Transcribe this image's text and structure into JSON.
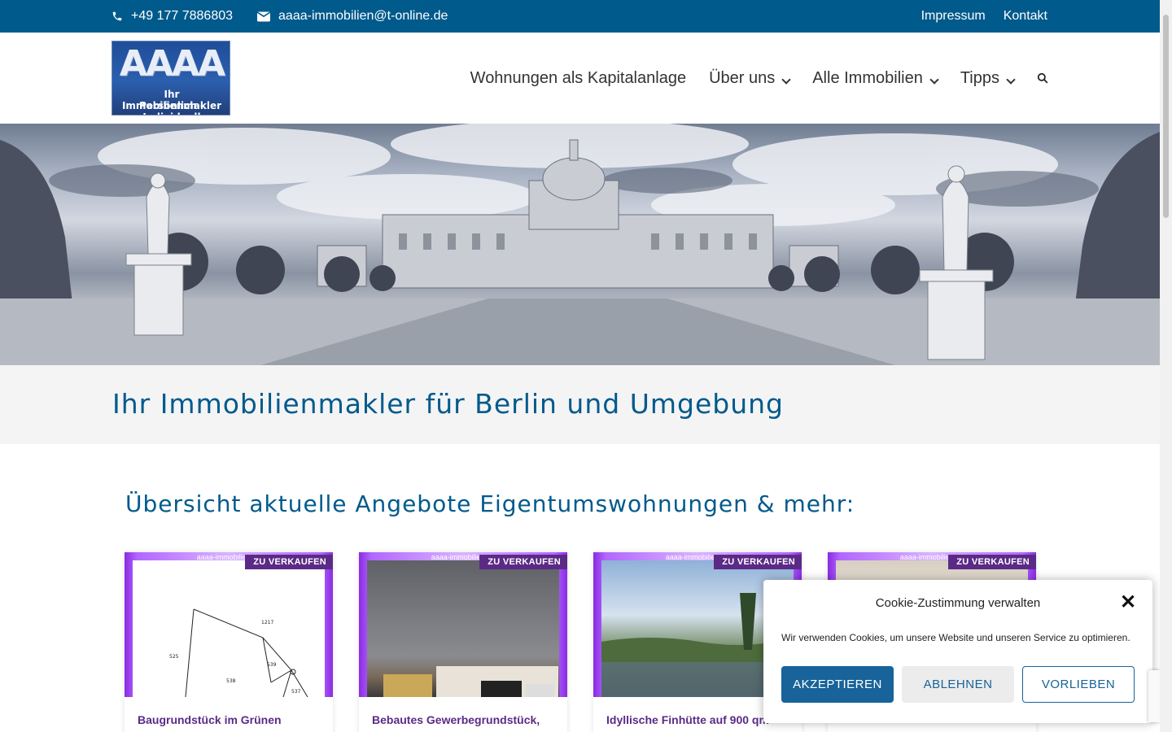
{
  "topbar": {
    "phone": "+49 177 7886803",
    "email": "aaaa-immobilien@t-online.de",
    "links": [
      "Impressum",
      "Kontakt"
    ]
  },
  "logo": {
    "big": "AAAA",
    "line1": "Ihr Immobilienmakler",
    "line2": "Persönlich - Individuell"
  },
  "nav": {
    "items": [
      {
        "label": "Wohnungen als Kapitalanlage",
        "dropdown": false
      },
      {
        "label": "Über uns",
        "dropdown": true
      },
      {
        "label": "Alle Immobilien",
        "dropdown": true
      },
      {
        "label": "Tipps",
        "dropdown": true
      }
    ],
    "search_icon": "search-icon"
  },
  "page": {
    "title": "Ihr Immobilienmakler für Berlin und Umgebung",
    "subtitle": "Übersicht aktuelle Angebote Eigentumswohnungen & mehr:"
  },
  "cards": [
    {
      "badge": "ZU VERKAUFEN",
      "watermark": "aaaa-immobilien.de",
      "title": "Baugrundstück im Grünen"
    },
    {
      "badge": "ZU VERKAUFEN",
      "watermark": "aaaa-immobilien.de",
      "title": "Bebautes Gewerbegrundstück,"
    },
    {
      "badge": "ZU VERKAUFEN",
      "watermark": "aaaa-immobilien.de",
      "title": "Idyllische Finhütte auf 900 qm"
    },
    {
      "badge": "ZU VERKAUFEN",
      "watermark": "aaaa-immobilien.de",
      "title": ""
    }
  ],
  "cookie": {
    "heading": "Cookie-Zustimmung verwalten",
    "text": "Wir verwenden Cookies, um unsere Website und unseren Service zu optimieren.",
    "accept": "AKZEPTIEREN",
    "deny": "ABLEHNEN",
    "prefs": "VORLIEBEN"
  },
  "colors": {
    "brand": "#005a8c",
    "accent": "#5b2a86",
    "purple_frame": "#8a2be2"
  }
}
